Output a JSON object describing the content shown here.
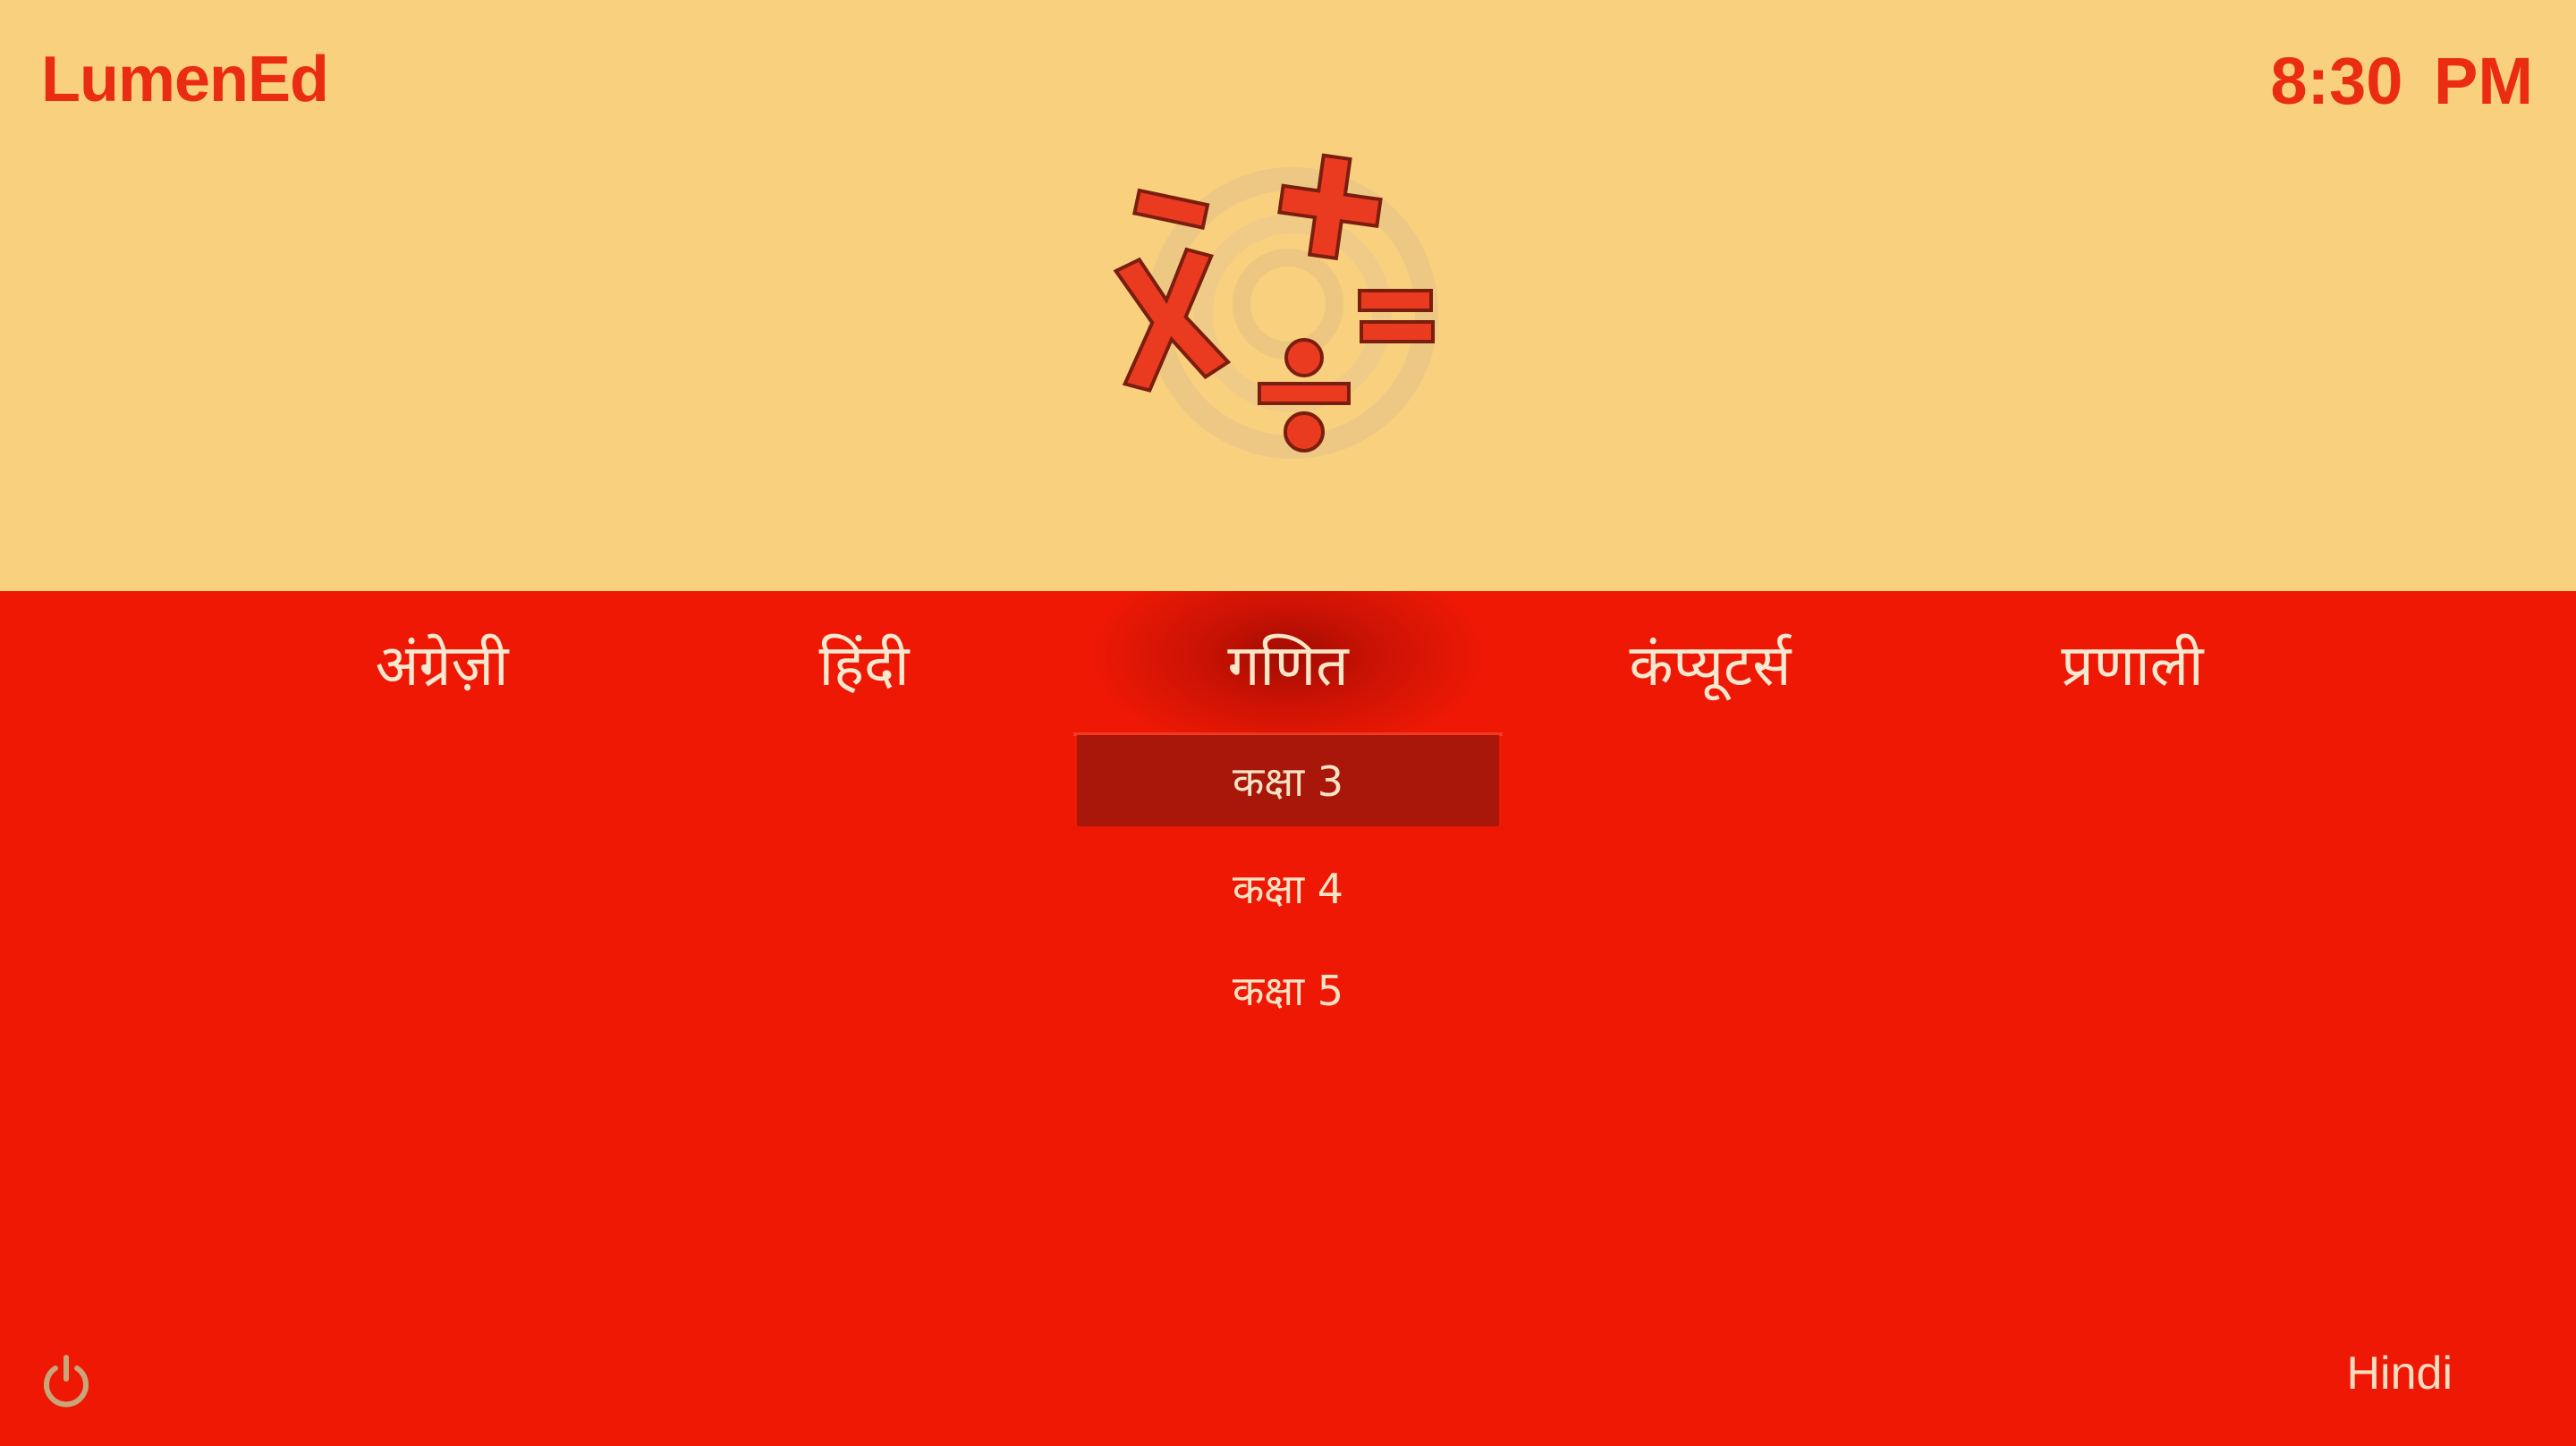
{
  "header": {
    "app_title": "LumenEd",
    "clock": "8:30 PM"
  },
  "logo": {
    "icon": "math-symbols-logo",
    "symbols": [
      "−",
      "+",
      "×",
      "=",
      "÷"
    ]
  },
  "subjects": [
    {
      "label": "अंग्रेज़ी",
      "active": false
    },
    {
      "label": "हिंदी",
      "active": false
    },
    {
      "label": "गणित",
      "active": true
    },
    {
      "label": "कंप्यूटर्स",
      "active": false
    },
    {
      "label": "प्रणाली",
      "active": false
    }
  ],
  "grades": [
    {
      "label": "कक्षा 3",
      "selected": true
    },
    {
      "label": "कक्षा 4",
      "selected": false
    },
    {
      "label": "कक्षा 5",
      "selected": false
    }
  ],
  "footer": {
    "power_icon": "power-icon",
    "language": "Hindi"
  },
  "colors": {
    "top_background": "#f9d07e",
    "bottom_background": "#ee1805",
    "accent": "#ea2c12",
    "selected_item": "#a8170a"
  }
}
